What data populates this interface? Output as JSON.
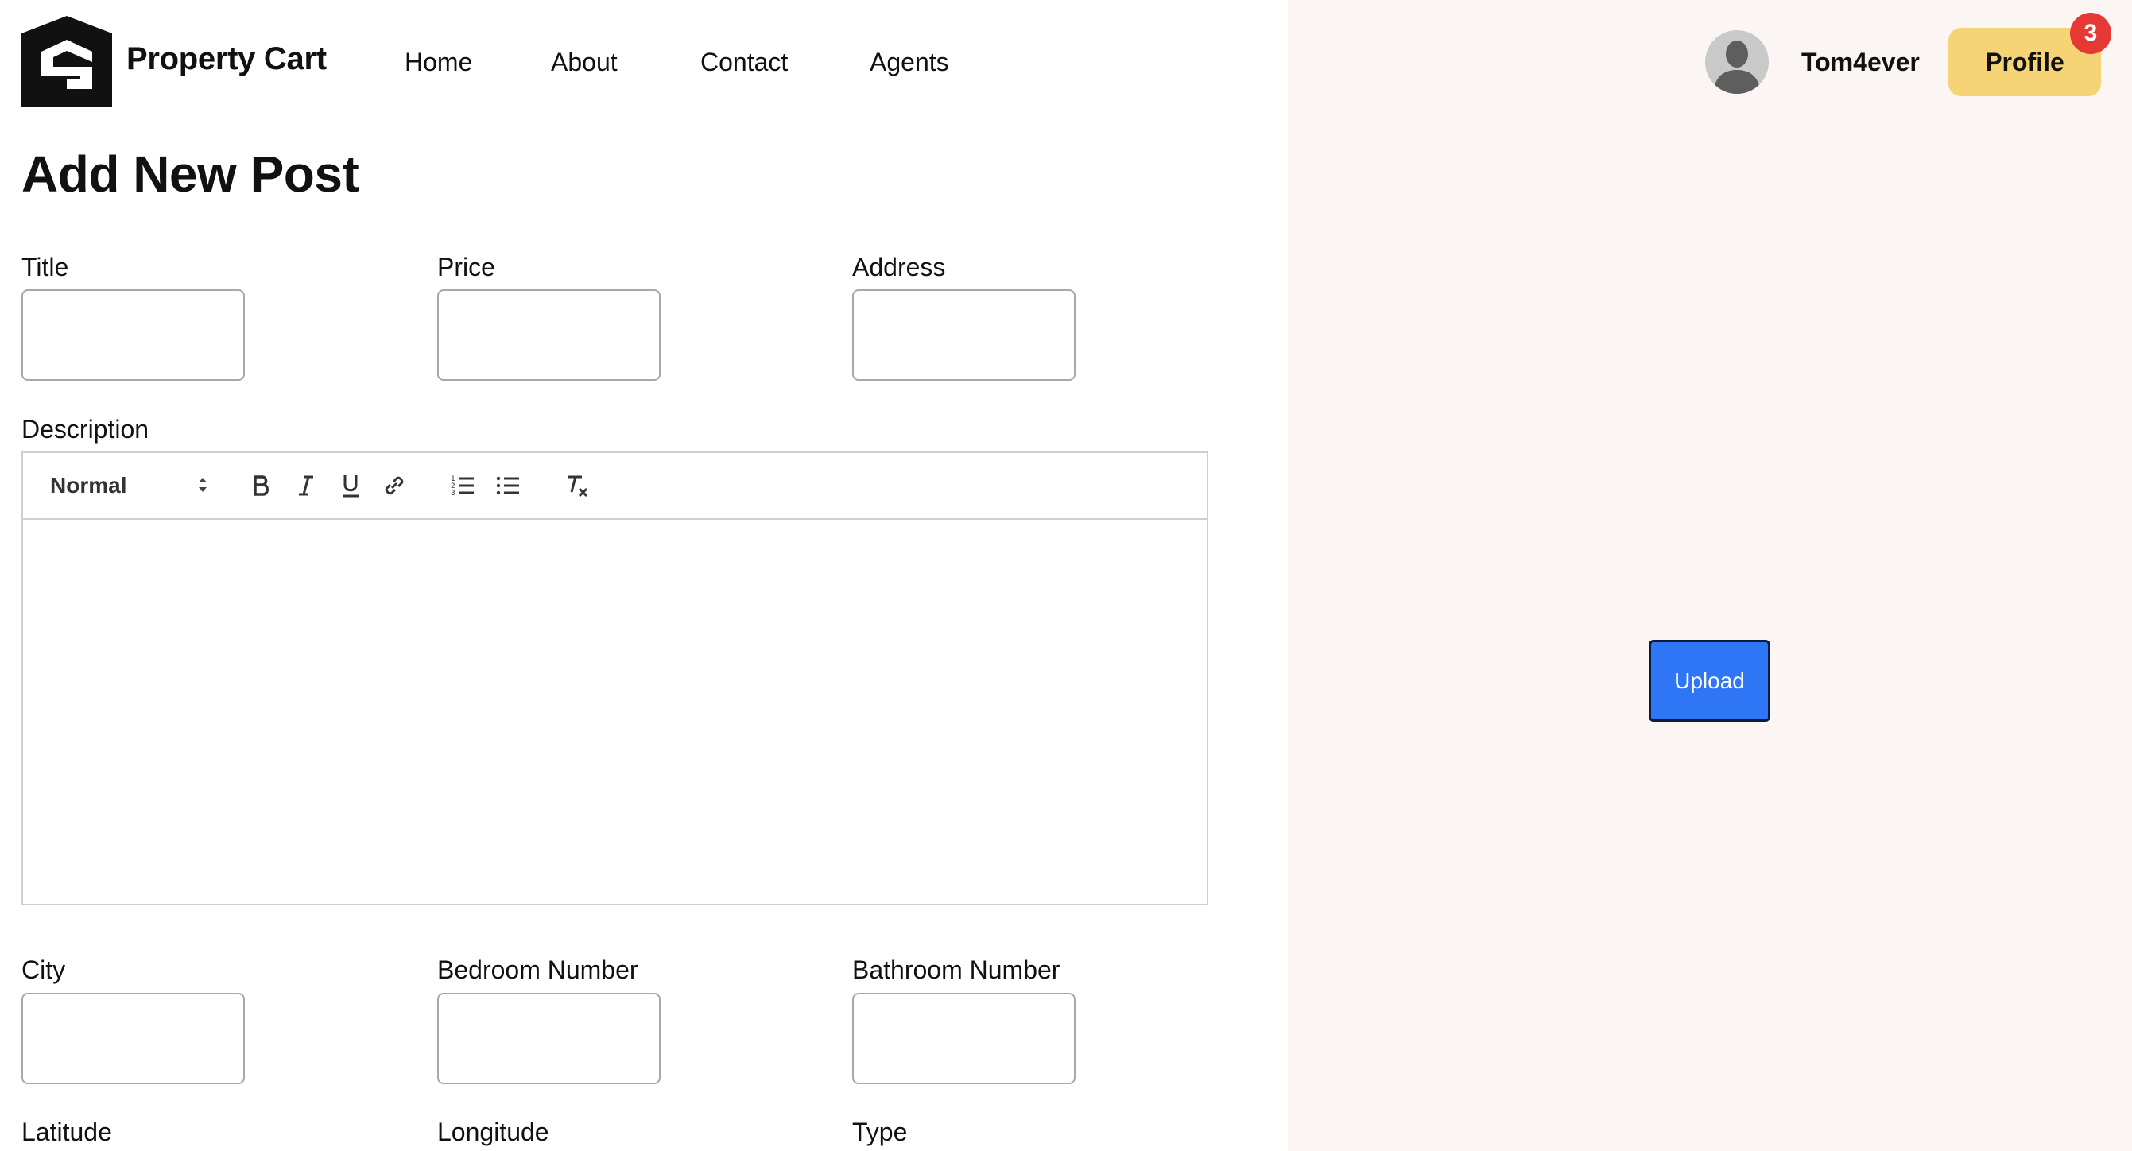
{
  "nav": {
    "brand": "Property Cart",
    "links": [
      "Home",
      "About",
      "Contact",
      "Agents"
    ],
    "username": "Tom4ever",
    "profile_label": "Profile",
    "notification_count": "3"
  },
  "form": {
    "title": "Add New Post",
    "labels": {
      "title": "Title",
      "price": "Price",
      "address": "Address",
      "description": "Description",
      "city": "City",
      "bedroom": "Bedroom Number",
      "bathroom": "Bathroom Number",
      "latitude": "Latitude",
      "longitude": "Longitude",
      "type": "Type"
    },
    "values": {
      "title": "",
      "price": "",
      "address": "",
      "city": "",
      "bedroom": "",
      "bathroom": ""
    },
    "editor": {
      "format_value": "Normal",
      "tools": [
        "bold-icon",
        "italic-icon",
        "underline-icon",
        "link-icon",
        "ordered-list-icon",
        "bullet-list-icon",
        "clear-format-icon"
      ]
    }
  },
  "upload": {
    "label": "Upload"
  },
  "colors": {
    "panel_bg": "#fbf5f3",
    "profile_bg": "#f6d375",
    "badge_bg": "#e53935",
    "upload_bg": "#2f76f6"
  }
}
